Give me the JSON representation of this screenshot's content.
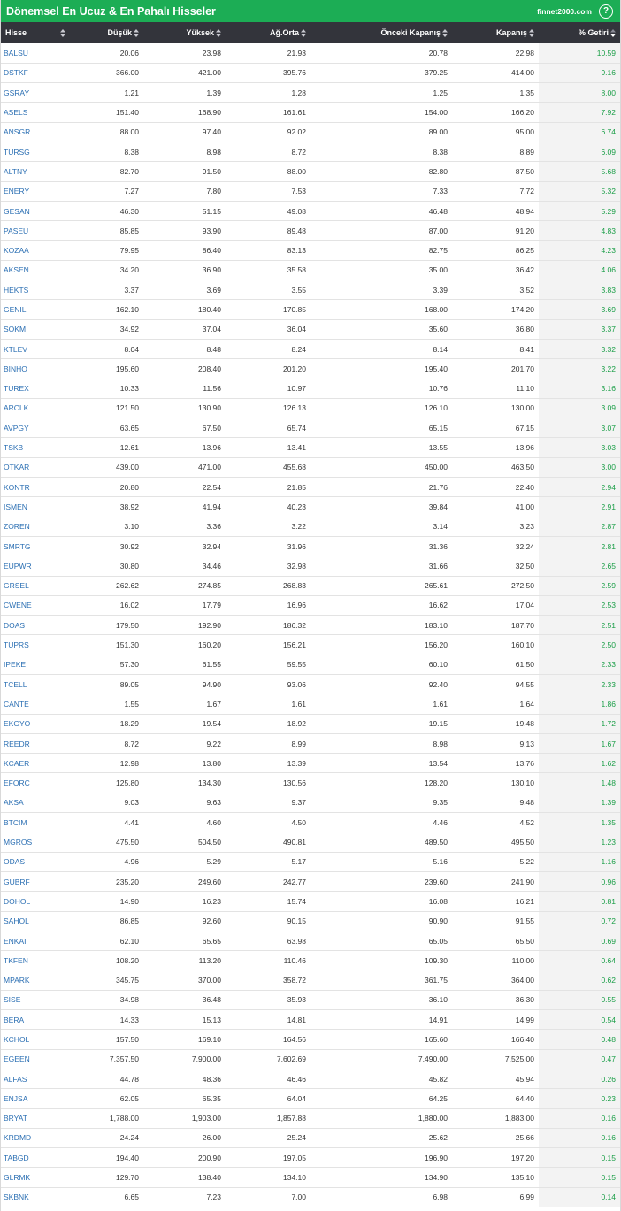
{
  "header": {
    "title": "Dönemsel En Ucuz & En Pahalı Hisseler",
    "brand": "finnet2000.com",
    "help_label": "?"
  },
  "colors": {
    "accent": "#1cad55",
    "header_bg": "#33343b",
    "symbol": "#2b6fb3",
    "positive": "#1a9e47"
  },
  "table": {
    "columns": [
      "Hisse",
      "Düşük",
      "Yüksek",
      "Ağ.Orta",
      "Önceki Kapanış",
      "Kapanış",
      "% Getiri"
    ],
    "sorted_column": "% Getiri",
    "sort_direction": "desc",
    "rows": [
      [
        "BALSU",
        "20.06",
        "23.98",
        "21.93",
        "20.78",
        "22.98",
        "10.59"
      ],
      [
        "DSTKF",
        "366.00",
        "421.00",
        "395.76",
        "379.25",
        "414.00",
        "9.16"
      ],
      [
        "GSRAY",
        "1.21",
        "1.39",
        "1.28",
        "1.25",
        "1.35",
        "8.00"
      ],
      [
        "ASELS",
        "151.40",
        "168.90",
        "161.61",
        "154.00",
        "166.20",
        "7.92"
      ],
      [
        "ANSGR",
        "88.00",
        "97.40",
        "92.02",
        "89.00",
        "95.00",
        "6.74"
      ],
      [
        "TURSG",
        "8.38",
        "8.98",
        "8.72",
        "8.38",
        "8.89",
        "6.09"
      ],
      [
        "ALTNY",
        "82.70",
        "91.50",
        "88.00",
        "82.80",
        "87.50",
        "5.68"
      ],
      [
        "ENERY",
        "7.27",
        "7.80",
        "7.53",
        "7.33",
        "7.72",
        "5.32"
      ],
      [
        "GESAN",
        "46.30",
        "51.15",
        "49.08",
        "46.48",
        "48.94",
        "5.29"
      ],
      [
        "PASEU",
        "85.85",
        "93.90",
        "89.48",
        "87.00",
        "91.20",
        "4.83"
      ],
      [
        "KOZAA",
        "79.95",
        "86.40",
        "83.13",
        "82.75",
        "86.25",
        "4.23"
      ],
      [
        "AKSEN",
        "34.20",
        "36.90",
        "35.58",
        "35.00",
        "36.42",
        "4.06"
      ],
      [
        "HEKTS",
        "3.37",
        "3.69",
        "3.55",
        "3.39",
        "3.52",
        "3.83"
      ],
      [
        "GENIL",
        "162.10",
        "180.40",
        "170.85",
        "168.00",
        "174.20",
        "3.69"
      ],
      [
        "SOKM",
        "34.92",
        "37.04",
        "36.04",
        "35.60",
        "36.80",
        "3.37"
      ],
      [
        "KTLEV",
        "8.04",
        "8.48",
        "8.24",
        "8.14",
        "8.41",
        "3.32"
      ],
      [
        "BINHO",
        "195.60",
        "208.40",
        "201.20",
        "195.40",
        "201.70",
        "3.22"
      ],
      [
        "TUREX",
        "10.33",
        "11.56",
        "10.97",
        "10.76",
        "11.10",
        "3.16"
      ],
      [
        "ARCLK",
        "121.50",
        "130.90",
        "126.13",
        "126.10",
        "130.00",
        "3.09"
      ],
      [
        "AVPGY",
        "63.65",
        "67.50",
        "65.74",
        "65.15",
        "67.15",
        "3.07"
      ],
      [
        "TSKB",
        "12.61",
        "13.96",
        "13.41",
        "13.55",
        "13.96",
        "3.03"
      ],
      [
        "OTKAR",
        "439.00",
        "471.00",
        "455.68",
        "450.00",
        "463.50",
        "3.00"
      ],
      [
        "KONTR",
        "20.80",
        "22.54",
        "21.85",
        "21.76",
        "22.40",
        "2.94"
      ],
      [
        "ISMEN",
        "38.92",
        "41.94",
        "40.23",
        "39.84",
        "41.00",
        "2.91"
      ],
      [
        "ZOREN",
        "3.10",
        "3.36",
        "3.22",
        "3.14",
        "3.23",
        "2.87"
      ],
      [
        "SMRTG",
        "30.92",
        "32.94",
        "31.96",
        "31.36",
        "32.24",
        "2.81"
      ],
      [
        "EUPWR",
        "30.80",
        "34.46",
        "32.98",
        "31.66",
        "32.50",
        "2.65"
      ],
      [
        "GRSEL",
        "262.62",
        "274.85",
        "268.83",
        "265.61",
        "272.50",
        "2.59"
      ],
      [
        "CWENE",
        "16.02",
        "17.79",
        "16.96",
        "16.62",
        "17.04",
        "2.53"
      ],
      [
        "DOAS",
        "179.50",
        "192.90",
        "186.32",
        "183.10",
        "187.70",
        "2.51"
      ],
      [
        "TUPRS",
        "151.30",
        "160.20",
        "156.21",
        "156.20",
        "160.10",
        "2.50"
      ],
      [
        "IPEKE",
        "57.30",
        "61.55",
        "59.55",
        "60.10",
        "61.50",
        "2.33"
      ],
      [
        "TCELL",
        "89.05",
        "94.90",
        "93.06",
        "92.40",
        "94.55",
        "2.33"
      ],
      [
        "CANTE",
        "1.55",
        "1.67",
        "1.61",
        "1.61",
        "1.64",
        "1.86"
      ],
      [
        "EKGYO",
        "18.29",
        "19.54",
        "18.92",
        "19.15",
        "19.48",
        "1.72"
      ],
      [
        "REEDR",
        "8.72",
        "9.22",
        "8.99",
        "8.98",
        "9.13",
        "1.67"
      ],
      [
        "KCAER",
        "12.98",
        "13.80",
        "13.39",
        "13.54",
        "13.76",
        "1.62"
      ],
      [
        "EFORC",
        "125.80",
        "134.30",
        "130.56",
        "128.20",
        "130.10",
        "1.48"
      ],
      [
        "AKSA",
        "9.03",
        "9.63",
        "9.37",
        "9.35",
        "9.48",
        "1.39"
      ],
      [
        "BTCIM",
        "4.41",
        "4.60",
        "4.50",
        "4.46",
        "4.52",
        "1.35"
      ],
      [
        "MGROS",
        "475.50",
        "504.50",
        "490.81",
        "489.50",
        "495.50",
        "1.23"
      ],
      [
        "ODAS",
        "4.96",
        "5.29",
        "5.17",
        "5.16",
        "5.22",
        "1.16"
      ],
      [
        "GUBRF",
        "235.20",
        "249.60",
        "242.77",
        "239.60",
        "241.90",
        "0.96"
      ],
      [
        "DOHOL",
        "14.90",
        "16.23",
        "15.74",
        "16.08",
        "16.21",
        "0.81"
      ],
      [
        "SAHOL",
        "86.85",
        "92.60",
        "90.15",
        "90.90",
        "91.55",
        "0.72"
      ],
      [
        "ENKAI",
        "62.10",
        "65.65",
        "63.98",
        "65.05",
        "65.50",
        "0.69"
      ],
      [
        "TKFEN",
        "108.20",
        "113.20",
        "110.46",
        "109.30",
        "110.00",
        "0.64"
      ],
      [
        "MPARK",
        "345.75",
        "370.00",
        "358.72",
        "361.75",
        "364.00",
        "0.62"
      ],
      [
        "SISE",
        "34.98",
        "36.48",
        "35.93",
        "36.10",
        "36.30",
        "0.55"
      ],
      [
        "BERA",
        "14.33",
        "15.13",
        "14.81",
        "14.91",
        "14.99",
        "0.54"
      ],
      [
        "KCHOL",
        "157.50",
        "169.10",
        "164.56",
        "165.60",
        "166.40",
        "0.48"
      ],
      [
        "EGEEN",
        "7,357.50",
        "7,900.00",
        "7,602.69",
        "7,490.00",
        "7,525.00",
        "0.47"
      ],
      [
        "ALFAS",
        "44.78",
        "48.36",
        "46.46",
        "45.82",
        "45.94",
        "0.26"
      ],
      [
        "ENJSA",
        "62.05",
        "65.35",
        "64.04",
        "64.25",
        "64.40",
        "0.23"
      ],
      [
        "BRYAT",
        "1,788.00",
        "1,903.00",
        "1,857.88",
        "1,880.00",
        "1,883.00",
        "0.16"
      ],
      [
        "KRDMD",
        "24.24",
        "26.00",
        "25.24",
        "25.62",
        "25.66",
        "0.16"
      ],
      [
        "TABGD",
        "194.40",
        "200.90",
        "197.05",
        "196.90",
        "197.20",
        "0.15"
      ],
      [
        "GLRMK",
        "129.70",
        "138.40",
        "134.10",
        "134.90",
        "135.10",
        "0.15"
      ],
      [
        "SKBNK",
        "6.65",
        "7.23",
        "7.00",
        "6.98",
        "6.99",
        "0.14"
      ]
    ]
  }
}
